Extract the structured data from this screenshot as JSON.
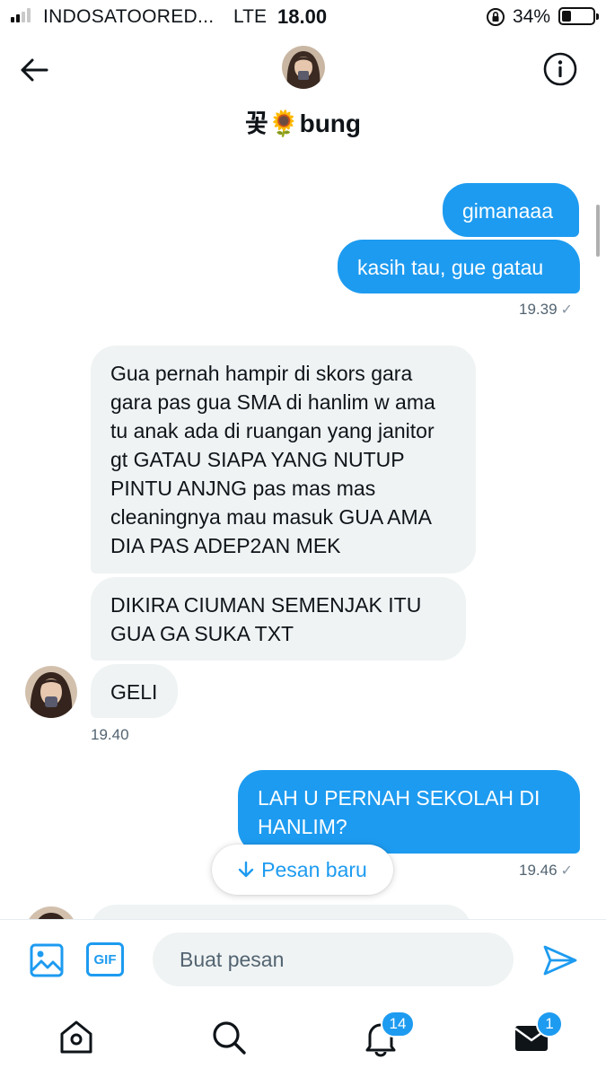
{
  "status_bar": {
    "carrier": "INDOSATOORED...",
    "network": "LTE",
    "time": "18.00",
    "battery_percent": "34%",
    "battery_level": 0.34,
    "signal_bars": 2
  },
  "header": {
    "conversation_name": "꽃🌻bung",
    "back_icon": "arrow-left-icon",
    "info_icon": "info-circle-icon"
  },
  "messages": [
    {
      "direction": "out",
      "text": "gimanaaa"
    },
    {
      "direction": "out",
      "text": "kasih tau, gue gatau",
      "timestamp": "19.39",
      "status": "✓"
    },
    {
      "direction": "in",
      "text": "Gua pernah hampir di skors gara gara pas gua SMA di hanlim w ama tu anak ada di ruangan yang janitor gt GATAU SIAPA YANG NUTUP PINTU ANJNG pas mas mas cleaningnya mau masuk GUA AMA DIA PAS ADEP2AN MEK"
    },
    {
      "direction": "in",
      "text": "DIKIRA CIUMAN SEMENJAK ITU GUA GA SUKA TXT"
    },
    {
      "direction": "in",
      "text": "GELI",
      "timestamp": "19.40"
    },
    {
      "direction": "out",
      "text": "LAH U PERNAH SEKOLAH DI HANLIM?",
      "timestamp": "19.46",
      "status": "✓"
    }
  ],
  "new_messages_pill": {
    "label": "Pesan baru",
    "icon": "arrow-down-icon"
  },
  "composer": {
    "placeholder": "Buat pesan",
    "media_icon": "image-icon",
    "gif_label": "GIF",
    "send_icon": "send-icon"
  },
  "tabbar": {
    "home_icon": "home-icon",
    "search_icon": "search-icon",
    "notifications_icon": "bell-icon",
    "notifications_badge": "14",
    "messages_icon": "envelope-icon",
    "messages_badge": "1"
  },
  "colors": {
    "accent": "#1d9bf0",
    "incoming_bubble": "#eff3f4",
    "text_primary": "#0f1419",
    "text_secondary": "#536471"
  }
}
